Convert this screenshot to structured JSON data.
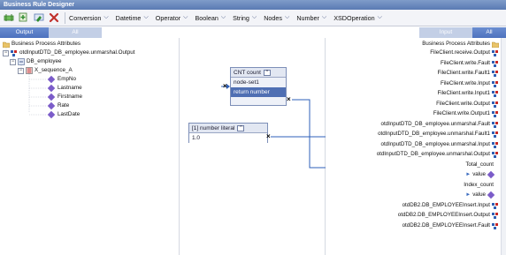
{
  "window": {
    "title": "Business Rule Designer"
  },
  "toolbar": {
    "icons": [
      "add-rule-icon",
      "insert-icon",
      "rename-icon",
      "delete-icon"
    ],
    "menus": [
      "Conversion",
      "Datetime",
      "Operator",
      "Boolean",
      "String",
      "Nodes",
      "Number",
      "XSDOperation"
    ]
  },
  "tabs": {
    "output": "Output",
    "all_left": "All",
    "input": "Input",
    "all_right": "All"
  },
  "left_tree": {
    "root": "Business Process Attributes",
    "node1": "otdInputDTD_DB_employee.unmarshal.Output",
    "node2": "DB_employee",
    "node3": "X_sequence_A",
    "leaves": [
      "EmpNo",
      "Lastname",
      "Firstname",
      "Rate",
      "LastDate"
    ]
  },
  "count_box": {
    "header": "CNT  count",
    "rows": [
      "node-set1",
      "return number"
    ]
  },
  "literal_box": {
    "header": "[1]  number literal",
    "value": "1.0"
  },
  "right_list": {
    "header": "Business Process Attributes",
    "items": [
      "FileClient.receive.Output",
      "FileClient.write.Fault",
      "FileClient.write.Fault1",
      "FileClient.write.Input",
      "FileClient.write.Input1",
      "FileClient.write.Output",
      "FileClient.write.Output1",
      "otdInputDTD_DB_employee.unmarshal.Fault",
      "otdInputDTD_DB_employee.unmarshal.Fault1",
      "otdInputDTD_DB_employee.unmarshal.Input",
      "otdInputDTD_DB_employee.unmarshal.Output",
      "Total_count",
      "value",
      "Index_count",
      "value",
      "otdDB2.DB_EMPLOYEEInsert.Input",
      "otdDB2.DB_EMPLOYEEInsert.Output",
      "otdDB2.DB_EMPLOYEEInsert.Fault"
    ]
  },
  "colors": {
    "accent": "#4f6fb3",
    "title_bar": "#6b87bf",
    "link_line": "#2e5fb8"
  }
}
